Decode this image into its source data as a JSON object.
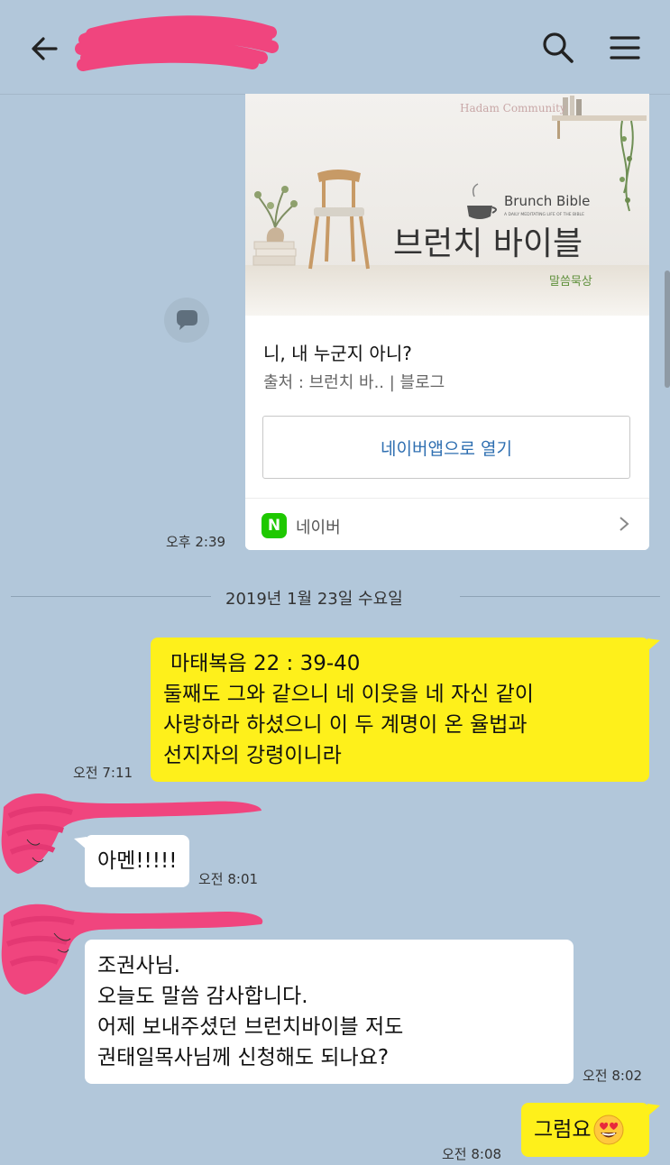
{
  "header": {
    "back_icon": "arrow-left-icon",
    "search_icon": "search-icon",
    "menu_icon": "hamburger-menu-icon"
  },
  "link_card": {
    "image": {
      "watermark": "Hadam Community",
      "brand_en": "Brunch Bible",
      "brand_tagline": "A DAILY MEDITATING LIFE OF THE BIBLE",
      "brand_kr": "브런치 바이블",
      "subtitle": "말씀묵상"
    },
    "title": "니, 내 누군지 아니?",
    "source": "출처 : 브런치 바.. | 블로그",
    "open_button": "네이버앱으로 열기",
    "footer_label": "네이버",
    "footer_badge": "N",
    "time": "오후 2:39"
  },
  "date_divider": "2019년 1월 23일 수요일",
  "messages": [
    {
      "side": "mine",
      "lines": [
        "마태복음 22 : 39-40",
        "둘째도 그와 같으니 네 이웃을 네 자신 같이",
        "사랑하라 하셨으니 이 두 계명이 온 율법과",
        "선지자의 강령이니라"
      ],
      "time": "오전 7:11"
    },
    {
      "side": "theirs",
      "lines": [
        "아멘!!!!!"
      ],
      "time": "오전 8:01"
    },
    {
      "side": "theirs",
      "lines": [
        "조권사님.",
        "오늘도 말씀 감사합니다.",
        "어제 보내주셨던 브런치바이블 저도",
        "권태일목사님께 신청해도 되나요?"
      ],
      "time": "오전 8:02"
    },
    {
      "side": "mine",
      "lines": [
        "그럼요"
      ],
      "emoji": "😍",
      "time": "오전 8:08"
    }
  ],
  "colors": {
    "background": "#b2c7da",
    "my_bubble": "#fef01b",
    "their_bubble": "#ffffff",
    "naver_green": "#1ec800",
    "link_blue": "#2f6fb1",
    "redaction_pink": "#f0457e"
  }
}
